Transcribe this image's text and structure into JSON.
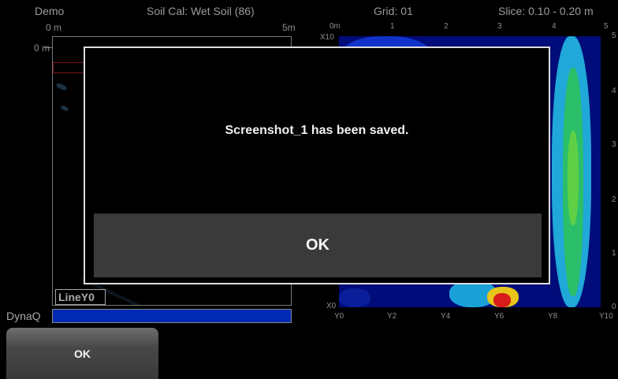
{
  "header": {
    "project": "Demo",
    "soil_cal": "Soil Cal: Wet Soil (86)",
    "grid": "Grid: 01",
    "slice": "Slice: 0.10 - 0.20 m"
  },
  "left_panel": {
    "x_start": "0 m",
    "x_end": "5m",
    "depth_top": "0 m",
    "line_label": "LineY0",
    "app_label": "DynaQ"
  },
  "right_panel": {
    "x_axis_top": [
      "0m",
      "1",
      "2",
      "3",
      "4",
      "5"
    ],
    "x_axis_bottom": [
      "Y0",
      "Y2",
      "Y4",
      "Y6",
      "Y8",
      "Y10"
    ],
    "left_labels": {
      "top": "X10",
      "bottom": "X0"
    },
    "y_axis_right": [
      "5",
      "4",
      "3",
      "2",
      "1",
      "0"
    ]
  },
  "dialog": {
    "message": "Screenshot_1 has been saved.",
    "ok_label": "OK"
  },
  "soft_key": {
    "ok_label": "OK"
  },
  "colors": {
    "map_background": "#000c7a",
    "dialog_button": "#3a3a3a",
    "progress": "#002ab4"
  }
}
